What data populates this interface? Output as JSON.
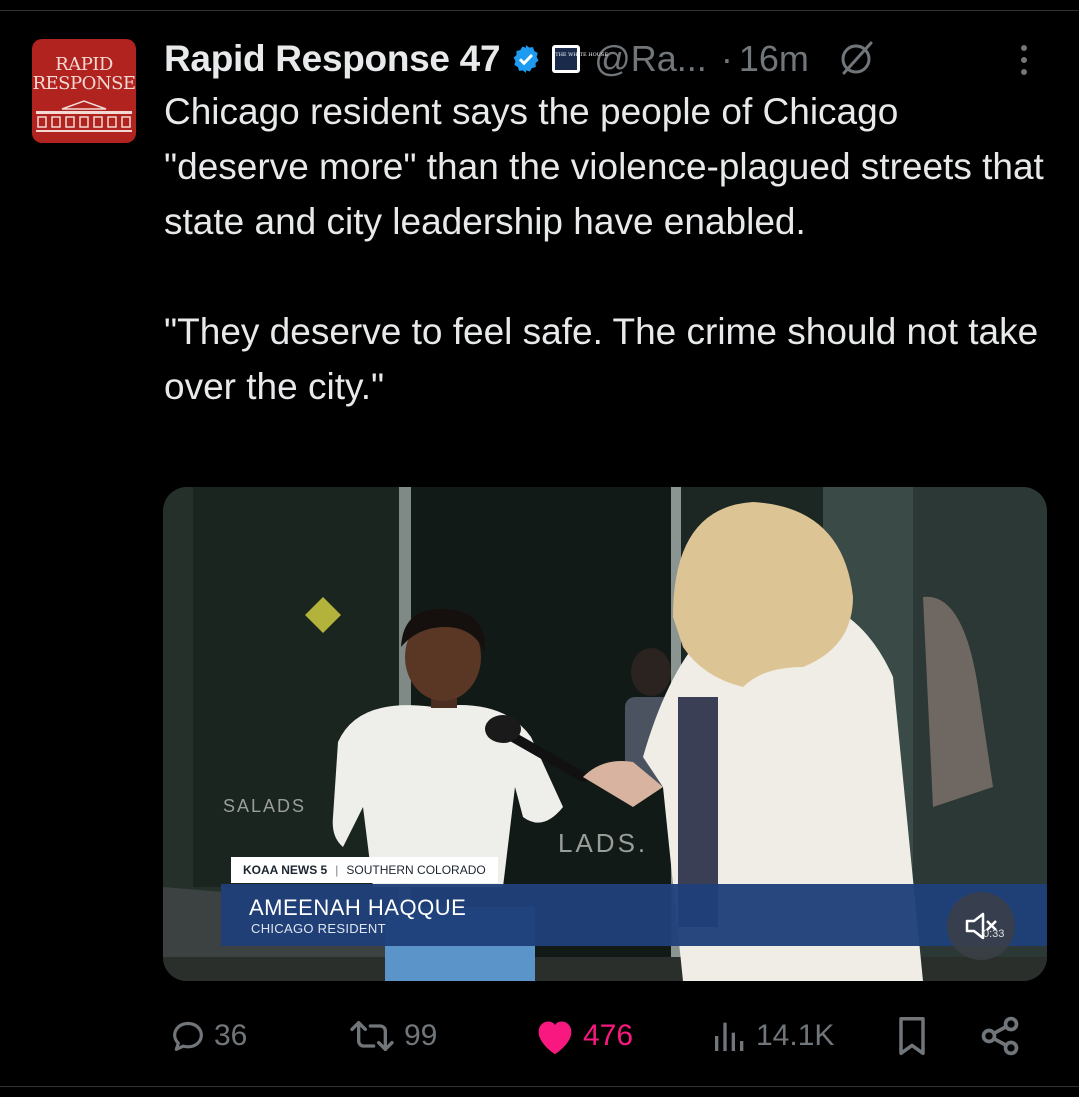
{
  "author": {
    "avatar_text": "RAPID\nRESPONSE",
    "name": "Rapid Response 47",
    "affiliate_badge_text": "THE WHITE HOUSE",
    "handle": "@Ra...",
    "separator": "·",
    "time": "16m"
  },
  "tweet": {
    "text": "Chicago resident says the people of Chicago \"deserve more\" than the violence-plagued streets that state and city leadership have enabled.\n\n\"They deserve to feel safe. The crime should not take over the city.\""
  },
  "media": {
    "tag_station": "KOAA NEWS 5",
    "tag_region": "SOUTHERN COLORADO",
    "lower_third_name": "AMEENAH HAQQUE",
    "lower_third_role": "CHICAGO RESIDENT",
    "bg_sign_text_left": "SALADS",
    "bg_sign_text_right": "LADS.",
    "duration": "0:33"
  },
  "actions": {
    "replies": "36",
    "reposts": "99",
    "likes": "476",
    "views": "14.1K"
  },
  "colors": {
    "background": "#000000",
    "text": "#e7e9ea",
    "muted": "#71767b",
    "like": "#f91880",
    "verified": "#1d9bf0",
    "lower_third": "#1f3f7a"
  }
}
